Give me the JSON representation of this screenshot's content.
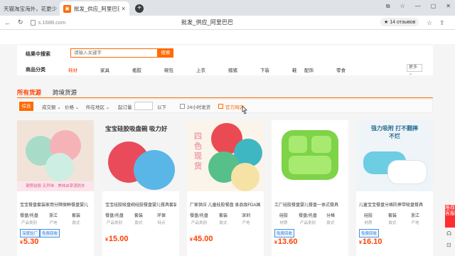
{
  "browser": {
    "inactive_tab_title": "天猫淘宝海外，花更少，买",
    "active_tab_title": "批发_供应_阿里巴巴",
    "url": "s.1688.com",
    "page_title": "批发_供应_阿里巴巴",
    "rating": "★ 14 отзывов",
    "new_tab_symbol": "+"
  },
  "filters": {
    "search_label": "结果中搜索",
    "search_placeholder": "请输入关键字",
    "search_button": "搜索",
    "category_label": "商品分类",
    "categories": [
      "耗材",
      "家具",
      "瓶胶",
      "碗包",
      "上衣",
      "猪猪",
      "下装",
      "鞋",
      "配饰",
      "零食"
    ],
    "more_label": "更多"
  },
  "main_tabs": [
    "所有货源",
    "跨境货源"
  ],
  "sortbar": {
    "active": "综合",
    "items": [
      "成交额",
      "价格",
      "所在地区",
      "起订量",
      "以下",
      "24小时发货",
      "官方网店"
    ]
  },
  "products": [
    {
      "title": "宝宝餐盘套装家用分隔保鲜餐盘婴儿",
      "attrs": [
        [
          "餐盘/托盘",
          "产品类别"
        ],
        [
          "浙江",
          "产地"
        ],
        [
          "套装",
          "款式"
        ]
      ],
      "badges": [
        "深度验厂",
        "免费回收"
      ],
      "price": "5.30",
      "banner": "硬质硅胶 无异味 · 美味由掌源防外"
    },
    {
      "title": "宝宝硅胶吸盘碗硅胶餐盘婴儿餐具套装",
      "attrs": [
        [
          "餐盘/托盘",
          "产品类别"
        ],
        [
          "套装",
          "款式"
        ],
        [
          "环保",
          "特点"
        ]
      ],
      "badges": [],
      "price": "15.00",
      "banner": "宝宝硅胶吸盘碗 吸力好"
    },
    {
      "title": "厂家供应 儿童硅胶餐盘 食品级FDA国",
      "attrs": [
        [
          "餐盘/托盘",
          "产品类别"
        ],
        [
          "套装",
          "款式"
        ],
        [
          "深圳",
          "产地"
        ]
      ],
      "badges": [],
      "price": "45.00",
      "banner": "四色现货"
    },
    {
      "title": "工厂硅胶餐盘婴儿餐盘一体式餐具",
      "attrs": [
        [
          "硅胶",
          "材质"
        ],
        [
          "餐盘/托盘",
          "产品类别"
        ],
        [
          "分格",
          "款式"
        ]
      ],
      "badges": [
        "免费回收"
      ],
      "price": "13.60",
      "banner": ""
    },
    {
      "title": "儿童宝宝餐盘分格防摔带吸盘餐具",
      "attrs": [
        [
          "硅胶",
          "材质"
        ],
        [
          "套装",
          "款式"
        ],
        [
          "浙江",
          "产地"
        ]
      ],
      "badges": [
        "免费回收"
      ],
      "price": "16.10",
      "banner": "强力吸附 打不翻摔不烂"
    }
  ],
  "currency": "¥",
  "side_ad": "推荐 客服",
  "colors": {
    "accent": "#ff6a00",
    "price": "#ff4000",
    "badge_blue": "#2f7fd8"
  }
}
